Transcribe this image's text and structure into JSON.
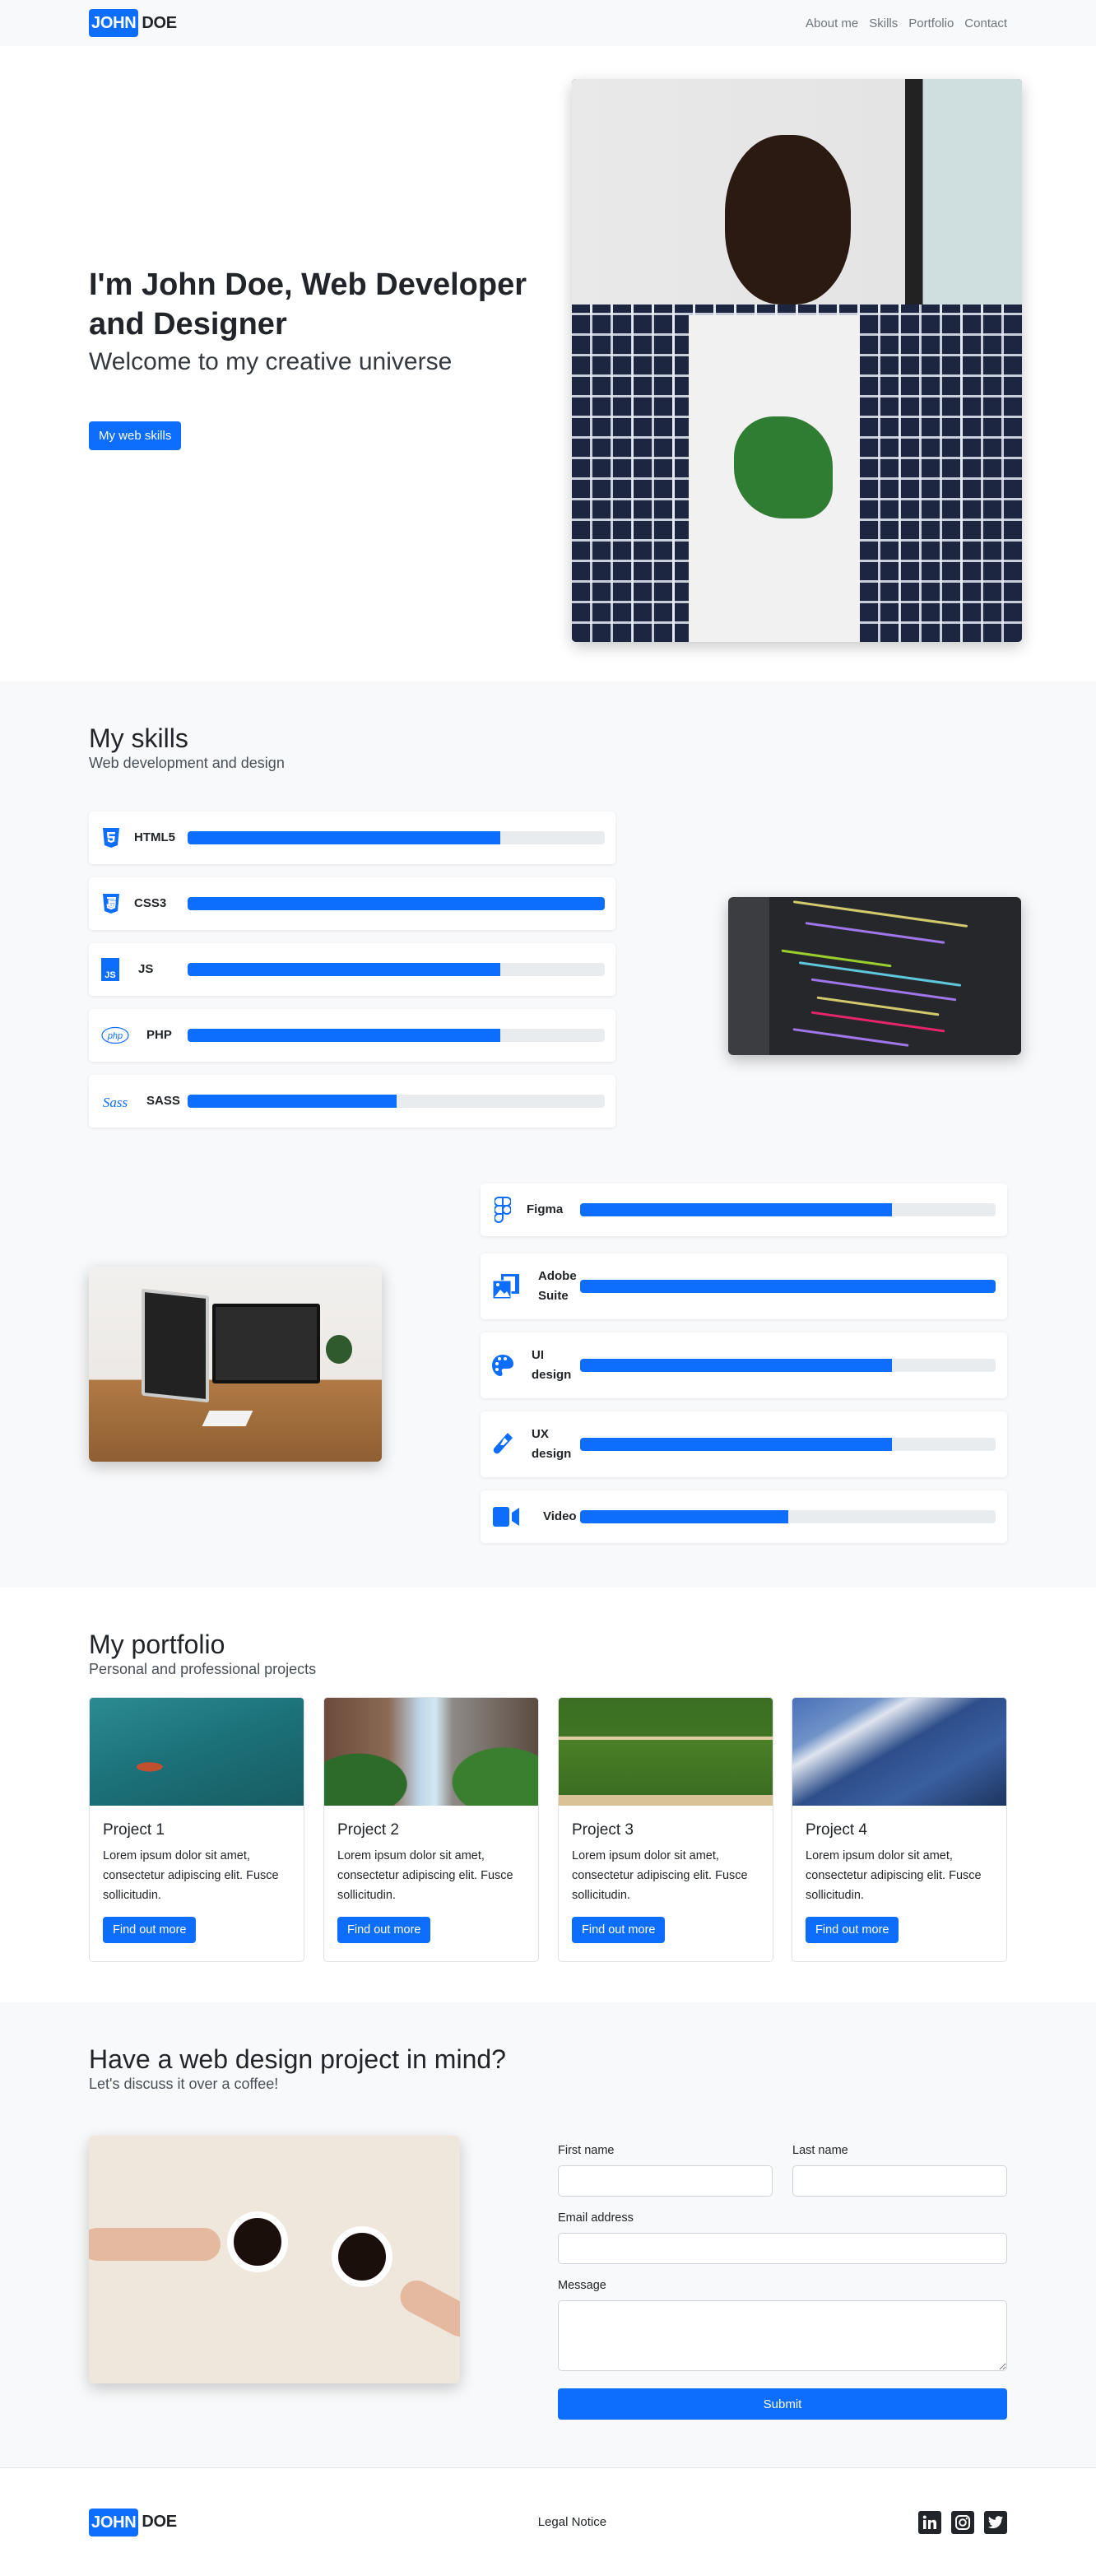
{
  "brand": {
    "first": "JOHN",
    "last": "DOE"
  },
  "nav": {
    "items": [
      {
        "label": "About me"
      },
      {
        "label": "Skills"
      },
      {
        "label": "Portfolio"
      },
      {
        "label": "Contact"
      }
    ]
  },
  "hero": {
    "title": "I'm John Doe, Web Developer and Designer",
    "subtitle": "Welcome to my creative universe",
    "button_label": "My web skills",
    "photo_icon": "portrait-photo"
  },
  "skills": {
    "title": "My skills",
    "subtitle": "Web development and design",
    "development": [
      {
        "name": "HTML5",
        "icon": "html5-icon",
        "level_percent": 75
      },
      {
        "name": "CSS3",
        "icon": "css3-icon",
        "level_percent": 100
      },
      {
        "name": "JS",
        "icon": "js-icon",
        "level_percent": 75
      },
      {
        "name": "PHP",
        "icon": "php-icon",
        "level_percent": 75
      },
      {
        "name": "SASS",
        "icon": "sass-icon",
        "level_percent": 50
      }
    ],
    "design": [
      {
        "name": "Figma",
        "icon": "figma-icon",
        "level_percent": 75
      },
      {
        "name": "Adobe Suite",
        "icon": "images-icon",
        "level_percent": 100
      },
      {
        "name": "UI design",
        "icon": "palette-icon",
        "level_percent": 75
      },
      {
        "name": "UX design",
        "icon": "test-tube-icon",
        "level_percent": 75
      },
      {
        "name": "Video",
        "icon": "video-camera-icon",
        "level_percent": 50
      }
    ]
  },
  "portfolio": {
    "title": "My portfolio",
    "subtitle": "Personal and professional projects",
    "projects": [
      {
        "title": "Project 1",
        "text": "Lorem ipsum dolor sit amet, consectetur adipiscing elit. Fusce sollicitudin.",
        "button_label": "Find out more"
      },
      {
        "title": "Project 2",
        "text": "Lorem ipsum dolor sit amet, consectetur adipiscing elit. Fusce sollicitudin.",
        "button_label": "Find out more"
      },
      {
        "title": "Project 3",
        "text": "Lorem ipsum dolor sit amet, consectetur adipiscing elit. Fusce sollicitudin.",
        "button_label": "Find out more"
      },
      {
        "title": "Project 4",
        "text": "Lorem ipsum dolor sit amet, consectetur adipiscing elit. Fusce sollicitudin.",
        "button_label": "Find out more"
      }
    ]
  },
  "contact": {
    "title": "Have a web design project in mind?",
    "subtitle": "Let's discuss it over a coffee!",
    "form": {
      "first_name_label": "First name",
      "first_name_value": "",
      "last_name_label": "Last name",
      "last_name_value": "",
      "email_label": "Email address",
      "email_value": "",
      "message_label": "Message",
      "message_value": "",
      "submit_label": "Submit"
    }
  },
  "footer": {
    "legal_label": "Legal Notice",
    "socials": [
      {
        "name": "linkedin-icon",
        "glyph": "in"
      },
      {
        "name": "instagram-icon",
        "glyph": "◎"
      },
      {
        "name": "twitter-icon",
        "glyph": "🐦"
      }
    ]
  },
  "colors": {
    "accent": "#0d6efd",
    "section_bg": "#f8f9fa",
    "text": "#212529",
    "track": "#e9ecef"
  }
}
